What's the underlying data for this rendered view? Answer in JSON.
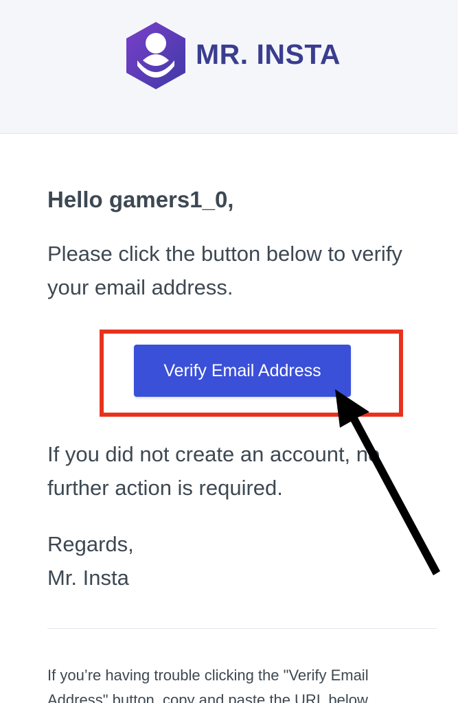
{
  "header": {
    "logo_icon": "person-badge-icon",
    "brand_name": "MR. INSTA",
    "brand_colors": [
      "#4b2fa8",
      "#7a3fc9",
      "#3a3d8f"
    ]
  },
  "email": {
    "greeting": "Hello gamers1_0,",
    "intro": "Please click the button below to verify your email address.",
    "button_label": "Verify Email Address",
    "button_color": "#3b50d8",
    "no_action": "If you did not create an account, no further action is required.",
    "regards_line": "Regards,",
    "signature": "Mr. Insta",
    "subcopy": "If you’re having trouble clicking the \"Verify Email Address\" button, copy and paste the URL below"
  },
  "annotations": {
    "highlight_color": "#e8321e",
    "arrow_icon": "pointer-arrow-icon",
    "arrow_color": "#000000"
  }
}
